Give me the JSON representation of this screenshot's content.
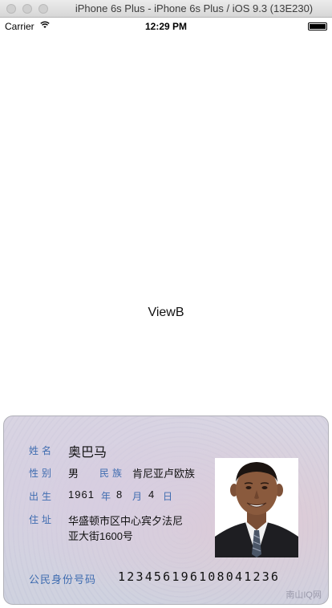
{
  "window": {
    "title": "iPhone 6s Plus - iPhone 6s Plus / iOS 9.3 (13E230)"
  },
  "status_bar": {
    "carrier": "Carrier",
    "time": "12:29 PM"
  },
  "main": {
    "view_label": "ViewB"
  },
  "id_card": {
    "name_label": "姓名",
    "name": "奥巴马",
    "sex_label": "性别",
    "sex": "男",
    "ethnicity_label": "民族",
    "ethnicity": "肯尼亚卢欧族",
    "birth_label": "出生",
    "birth_year": "1961",
    "year_unit": "年",
    "birth_month": "8",
    "month_unit": "月",
    "birth_day": "4",
    "day_unit": "日",
    "address_label": "住址",
    "address_line1": "华盛顿市区中心宾夕法尼",
    "address_line2": "亚大街1600号",
    "id_number_label": "公民身份号码",
    "id_number": "123456196108041236",
    "watermark": "南山IQ网"
  }
}
